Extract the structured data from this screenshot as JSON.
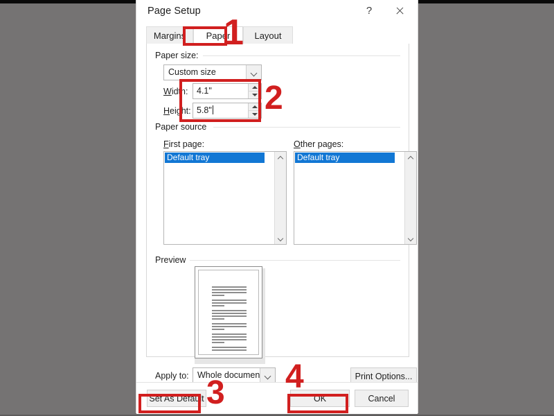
{
  "window": {
    "title": "Page Setup",
    "help_icon": "question-mark-icon",
    "close_icon": "close-icon"
  },
  "tabs": [
    {
      "label": "Margins",
      "active": false
    },
    {
      "label": "Paper",
      "active": true
    },
    {
      "label": "Layout",
      "active": false
    }
  ],
  "paper_size": {
    "group_label": "Paper size:",
    "size_value": "Custom size",
    "width_label": "Width:",
    "width_value": "4.1\"",
    "height_label": "Height:",
    "height_value": "5.8\""
  },
  "paper_source": {
    "group_label": "Paper source",
    "first_page_label": "First page:",
    "first_page_value": "Default tray",
    "other_pages_label": "Other pages:",
    "other_pages_value": "Default tray"
  },
  "preview": {
    "group_label": "Preview"
  },
  "apply": {
    "label": "Apply to:",
    "value": "Whole document",
    "print_options_label": "Print Options..."
  },
  "footer": {
    "set_as_default_label": "Set As Default",
    "ok_label": "OK",
    "cancel_label": "Cancel"
  },
  "annotations": {
    "accent_color": "#d11f1f",
    "n1": "1",
    "n2": "2",
    "n3": "3",
    "n4": "4"
  }
}
